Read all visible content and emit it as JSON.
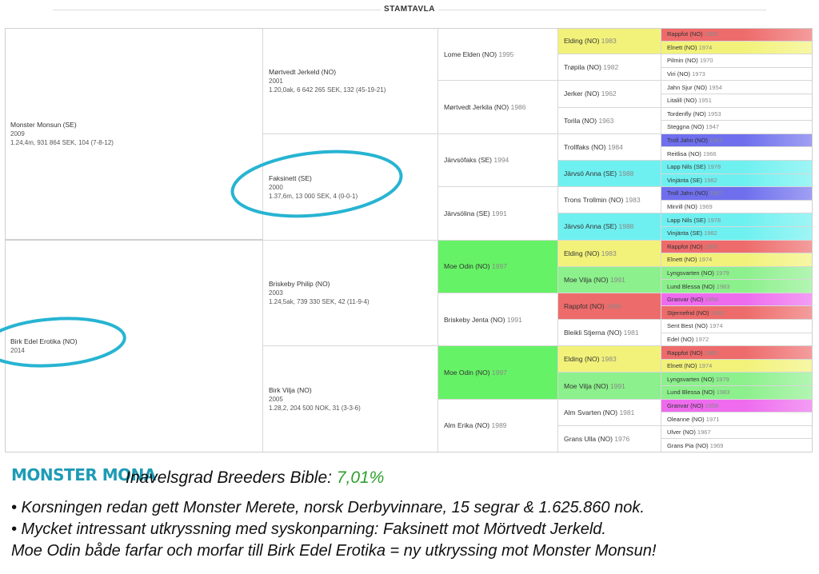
{
  "header": {
    "title": "STAMTAVLA"
  },
  "gen1": [
    {
      "name": "Monster Monsun (SE)",
      "year": "2009",
      "info": "1.24,4m, 931 864 SEK, 104 (7-8-12)"
    },
    {
      "name": "Birk Edel Erotika (NO)",
      "year": "2014",
      "info": ""
    }
  ],
  "gen2": [
    {
      "name": "Mørtvedt Jerkeld (NO)",
      "year": "2001",
      "info": "1.20,0ak, 6 642 265 SEK, 132 (45-19-21)"
    },
    {
      "name": "Faksinett (SE)",
      "year": "2000",
      "info": "1.37,6m, 13 000 SEK, 4 (0-0-1)"
    },
    {
      "name": "Briskeby Philip (NO)",
      "year": "2003",
      "info": "1.24,5ak, 739 330 SEK, 42 (11-9-4)"
    },
    {
      "name": "Birk Vilja (NO)",
      "year": "2005",
      "info": "1.28,2, 204 500 NOK, 31 (3-3-6)"
    }
  ],
  "gen3": [
    {
      "name": "Lome Elden (NO)",
      "year": "1995",
      "color": "#ffffff"
    },
    {
      "name": "Mørtvedt Jerkila (NO)",
      "year": "1986",
      "color": "#ffffff"
    },
    {
      "name": "Järvsöfaks (SE)",
      "year": "1994",
      "color": "#ffffff"
    },
    {
      "name": "Järvsölina (SE)",
      "year": "1991",
      "color": "#ffffff"
    },
    {
      "name": "Moe Odin (NO)",
      "year": "1997",
      "color": "#66f266"
    },
    {
      "name": "Briskeby Jenta (NO)",
      "year": "1991",
      "color": "#ffffff"
    },
    {
      "name": "Moe Odin (NO)",
      "year": "1997",
      "color": "#66f266"
    },
    {
      "name": "Alm Erika (NO)",
      "year": "1989",
      "color": "#ffffff"
    }
  ],
  "gen4": [
    {
      "name": "Elding (NO)",
      "year": "1983",
      "color": "#f2f27a"
    },
    {
      "name": "Trøpila (NO)",
      "year": "1982",
      "color": "#ffffff"
    },
    {
      "name": "Jerker (NO)",
      "year": "1962",
      "color": "#ffffff"
    },
    {
      "name": "Torila (NO)",
      "year": "1963",
      "color": "#ffffff"
    },
    {
      "name": "Trollfaks (NO)",
      "year": "1984",
      "color": "#ffffff"
    },
    {
      "name": "Järvsö Anna (SE)",
      "year": "1988",
      "color": "#6ff0f0"
    },
    {
      "name": "Trons Trollmin (NO)",
      "year": "1983",
      "color": "#ffffff"
    },
    {
      "name": "Järvsö Anna (SE)",
      "year": "1988",
      "color": "#6ff0f0"
    },
    {
      "name": "Elding (NO)",
      "year": "1983",
      "color": "#f2f27a"
    },
    {
      "name": "Moe Vilja (NO)",
      "year": "1991",
      "color": "#8cf08c"
    },
    {
      "name": "Rappfot (NO)",
      "year": "1965",
      "color": "#ee6b6b"
    },
    {
      "name": "Bleikli Stjerna (NO)",
      "year": "1981",
      "color": "#ffffff"
    },
    {
      "name": "Elding (NO)",
      "year": "1983",
      "color": "#f2f27a"
    },
    {
      "name": "Moe Vilja (NO)",
      "year": "1991",
      "color": "#8cf08c"
    },
    {
      "name": "Alm Svarten (NO)",
      "year": "1981",
      "color": "#ffffff"
    },
    {
      "name": "Grans Ulla (NO)",
      "year": "1976",
      "color": "#ffffff"
    }
  ],
  "gen5": [
    {
      "name": "Rappfot (NO)",
      "year": "1965",
      "color": "#ee6b6b"
    },
    {
      "name": "Elnett (NO)",
      "year": "1974",
      "color": "#f2f27a"
    },
    {
      "name": "Pilmin (NO)",
      "year": "1970",
      "color": "#ffffff"
    },
    {
      "name": "Viri (NO)",
      "year": "1973",
      "color": "#ffffff"
    },
    {
      "name": "Jahn Sjur (NO)",
      "year": "1954",
      "color": "#ffffff"
    },
    {
      "name": "Litalill (NO)",
      "year": "1951",
      "color": "#ffffff"
    },
    {
      "name": "Tordenfly (NO)",
      "year": "1953",
      "color": "#ffffff"
    },
    {
      "name": "Steggna (NO)",
      "year": "1947",
      "color": "#ffffff"
    },
    {
      "name": "Troll Jahn (NO)",
      "year": "1967",
      "color": "#6f6fee"
    },
    {
      "name": "Reitlisa (NO)",
      "year": "1966",
      "color": "#ffffff"
    },
    {
      "name": "Lapp Nils (SE)",
      "year": "1978",
      "color": "#6ff0f0"
    },
    {
      "name": "Vinjänta (SE)",
      "year": "1982",
      "color": "#6ff0f0"
    },
    {
      "name": "Troll Jahn (NO)",
      "year": "1967",
      "color": "#6f6fee"
    },
    {
      "name": "Minrill (NO)",
      "year": "1969",
      "color": "#ffffff"
    },
    {
      "name": "Lapp Nils (SE)",
      "year": "1978",
      "color": "#6ff0f0"
    },
    {
      "name": "Vinjänta (SE)",
      "year": "1982",
      "color": "#6ff0f0"
    },
    {
      "name": "Rappfot (NO)",
      "year": "1965",
      "color": "#ee6b6b"
    },
    {
      "name": "Elnett (NO)",
      "year": "1974",
      "color": "#f2f27a"
    },
    {
      "name": "Lyngsvarten (NO)",
      "year": "1979",
      "color": "#8cf08c"
    },
    {
      "name": "Lund Blessa (NO)",
      "year": "1983",
      "color": "#8cf08c"
    },
    {
      "name": "Granvar (NO)",
      "year": "1958",
      "color": "#ee6bee"
    },
    {
      "name": "Stjernefrid (NO)",
      "year": "1959",
      "color": "#ee6b6b"
    },
    {
      "name": "Sent Best (NO)",
      "year": "1974",
      "color": "#ffffff"
    },
    {
      "name": "Edel (NO)",
      "year": "1972",
      "color": "#ffffff"
    },
    {
      "name": "Rappfot (NO)",
      "year": "1965",
      "color": "#ee6b6b"
    },
    {
      "name": "Elnett (NO)",
      "year": "1974",
      "color": "#f2f27a"
    },
    {
      "name": "Lyngsvarten (NO)",
      "year": "1979",
      "color": "#8cf08c"
    },
    {
      "name": "Lund Blessa (NO)",
      "year": "1983",
      "color": "#8cf08c"
    },
    {
      "name": "Granvar (NO)",
      "year": "1958",
      "color": "#ee6bee"
    },
    {
      "name": "Oleanne (NO)",
      "year": "1971",
      "color": "#ffffff"
    },
    {
      "name": "Ulver (NO)",
      "year": "1967",
      "color": "#ffffff"
    },
    {
      "name": "Grans Pia (NO)",
      "year": "1969",
      "color": "#ffffff"
    }
  ],
  "footer": {
    "logo": "MONSTER MONA",
    "inavel_label": "Inavelsgrad Breeders Bible: ",
    "inavel_value": "7,01%",
    "line1": "• Korsningen redan gett Monster Merete, norsk Derbyvinnare, 15 segrar & 1.625.860 nok.",
    "line2": "• Mycket intressant utkryssning med syskonparning: Faksinett mot Mörtvedt Jerkeld.",
    "line3": "Moe Odin både farfar och morfar till Birk Edel Erotika = ny utkryssing mot Monster Monsun!"
  },
  "colors": {
    "accent": "#1e9bb5",
    "percent": "#2ea02e",
    "circle": "#27b4d2"
  }
}
